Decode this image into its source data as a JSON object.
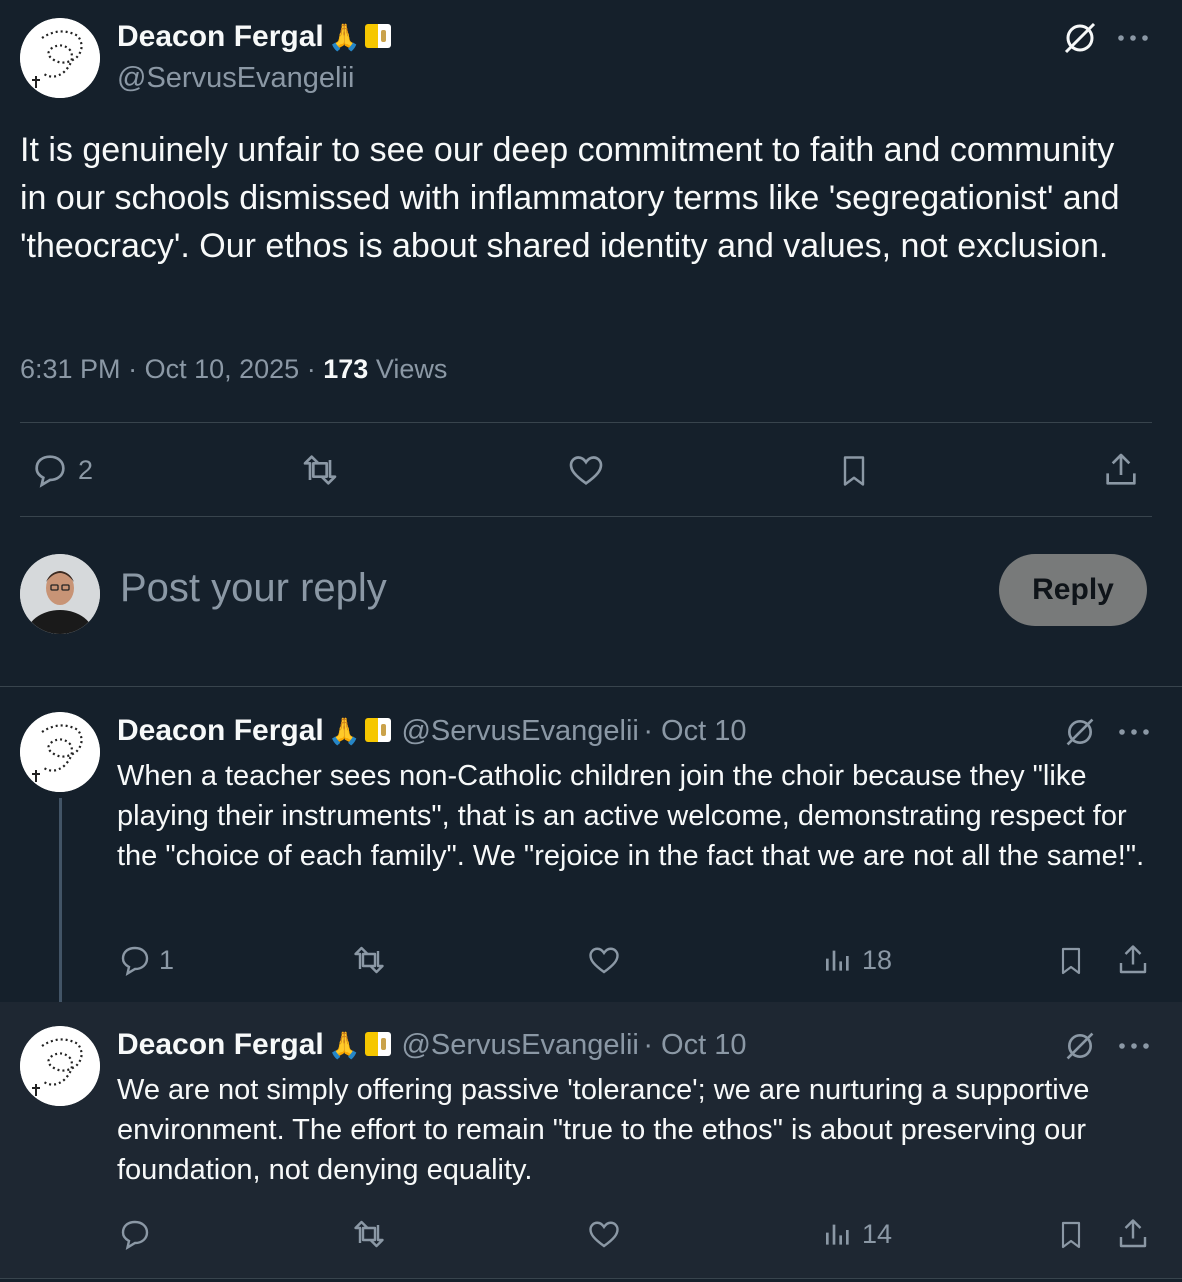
{
  "main_tweet": {
    "author_name": "Deacon Fergal",
    "emoji": "🙏",
    "handle": "@ServusEvangelii",
    "text": "It is genuinely unfair to see our deep commitment to faith and community in our schools dismissed with inflammatory terms like 'segregationist' and 'theocracy'. Our ethos is about shared identity and values, not exclusion.",
    "time": "6:31 PM",
    "sep": "·",
    "date": "Oct 10, 2025",
    "views_count": "173",
    "views_label": "Views",
    "reply_count": "2"
  },
  "compose": {
    "placeholder": "Post your reply",
    "button_label": "Reply"
  },
  "replies": [
    {
      "author_name": "Deacon Fergal",
      "emoji": "🙏",
      "handle": "@ServusEvangelii",
      "date": "· Oct 10",
      "text": "When a teacher sees non-Catholic children join the choir because they \"like playing their instruments\", that is an active welcome, demonstrating respect for the \"choice of each family\". We \"rejoice in the fact that we are not all the same!\".",
      "reply_count": "1",
      "views": "18"
    },
    {
      "author_name": "Deacon Fergal",
      "emoji": "🙏",
      "handle": "@ServusEvangelii",
      "date": "· Oct 10",
      "text": "We are not simply offering passive 'tolerance'; we are nurturing a supportive environment. The effort to remain \"true to the ethos\" is about preserving our foundation, not denying equality.",
      "reply_count": "",
      "views": "14"
    }
  ],
  "colors": {
    "background": "#15202b",
    "text": "#f7f9f9",
    "secondary_text": "#8b98a5",
    "divider": "#38444d",
    "reply_button": "#787a7a"
  },
  "icons": [
    "rosary-avatar-icon",
    "grok-icon",
    "more-icon",
    "reply-icon",
    "retweet-icon",
    "like-icon",
    "bookmark-icon",
    "share-icon",
    "views-icon",
    "vatican-flag-icon"
  ]
}
